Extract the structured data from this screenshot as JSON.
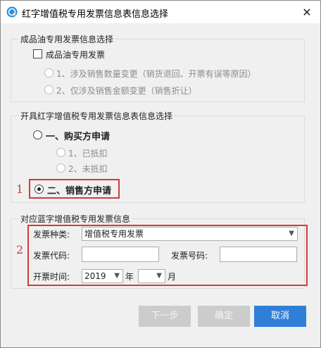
{
  "window": {
    "title": "红字增值税专用发票信息表信息选择",
    "close_glyph": "✕"
  },
  "group1": {
    "title": "成品油专用发票信息选择",
    "checkbox_label": "成品油专用发票",
    "option1": "1、涉及销售数量变更（销货退回、开票有误等原因）",
    "option2": "2、仅涉及销售金额变更（销售折让）"
  },
  "group2": {
    "title": "开具红字增值税专用发票信息表信息选择",
    "buyer_label": "一、购买方申请",
    "deducted_label": "1、已抵扣",
    "not_deducted_label": "2、未抵扣",
    "seller_label": "二、销售方申请"
  },
  "annotations": {
    "mark1": "1",
    "mark2": "2",
    "color": "#d23b3b"
  },
  "group3": {
    "title": "对应蓝字增值税专用发票信息",
    "invoice_type_label": "发票种类:",
    "invoice_type_value": "增值税专用发票",
    "invoice_code_label": "发票代码:",
    "invoice_code_value": "",
    "invoice_number_label": "发票号码:",
    "invoice_number_value": "",
    "issue_time_label": "开票时间:",
    "year_value": "2019",
    "year_unit": "年",
    "month_value": "",
    "month_unit": "月"
  },
  "buttons": {
    "next": "下一步",
    "confirm": "确定",
    "cancel": "取消"
  },
  "colors": {
    "accent": "#2f7fd7",
    "disabled_button": "#cccccc"
  },
  "icons": {
    "app": "app-logo-icon",
    "close": "close-icon",
    "dropdown": "chevron-down-icon"
  }
}
